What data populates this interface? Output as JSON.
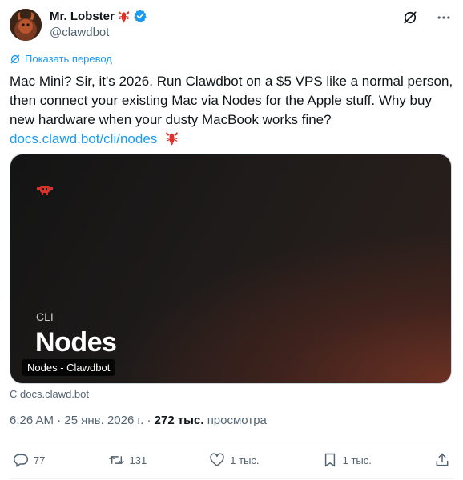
{
  "author": {
    "display_name": "Mr. Lobster",
    "handle": "@clawdbot"
  },
  "translate_label": "Показать перевод",
  "tweet": {
    "text": "Mac Mini? Sir, it's 2026. Run Clawdbot on a $5 VPS like a normal person, then connect your existing Mac via Nodes for the Apple stuff. Why buy new hardware when your dusty MacBook works fine?",
    "link_text": "docs.clawd.bot/cli/nodes"
  },
  "card": {
    "kicker": "CLI",
    "title": "Nodes",
    "label": "Nodes - Clawdbot",
    "source": "С docs.clawd.bot"
  },
  "meta": {
    "time": "6:26 AM",
    "date": "25 янв. 2026 г.",
    "views_count": "272 тыс.",
    "views_label": "просмотра"
  },
  "actions": {
    "replies": "77",
    "reposts": "131",
    "likes": "1 тыс.",
    "bookmarks": "1 тыс."
  },
  "colors": {
    "accent": "#1d9bf0",
    "text": "#0f1419",
    "secondary": "#536471",
    "lobster": "#e0302b"
  }
}
